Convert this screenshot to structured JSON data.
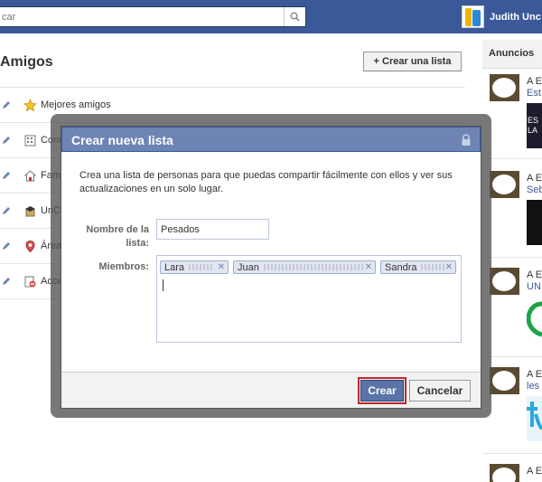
{
  "header": {
    "search_placeholder": "car",
    "user_name": "Judith Unc"
  },
  "page": {
    "title": "Amigos",
    "create_list_label": "+ Crear una lista"
  },
  "lists": [
    {
      "label": "Mejores amigos",
      "icon": "star-icon"
    },
    {
      "label": "Cono",
      "icon": "building-icon"
    },
    {
      "label": "Fam",
      "icon": "house-icon"
    },
    {
      "label": "UnC",
      "icon": "graduation-cap-icon"
    },
    {
      "label": "Área",
      "icon": "location-pin-icon"
    },
    {
      "label": "Acce",
      "icon": "restricted-icon"
    }
  ],
  "ads": {
    "header": "Anuncios",
    "items": [
      {
        "title": "A E",
        "subtitle": "Est",
        "image_text": "ES LA"
      },
      {
        "title": "A E",
        "subtitle": "Seb"
      },
      {
        "title": "A E",
        "subtitle": "UN"
      },
      {
        "title": "A E",
        "subtitle": "les"
      },
      {
        "title": "A E",
        "subtitle": ""
      }
    ]
  },
  "dialog": {
    "title": "Crear nueva lista",
    "description": "Crea una lista de personas para que puedas compartir fácilmente con ellos y ver sus actualizaciones en un solo lugar.",
    "name_label": "Nombre de la lista:",
    "name_value": "Pesados",
    "members_label": "Miembros:",
    "members": [
      "Lara",
      "Juan",
      "Sandra"
    ],
    "create_label": "Crear",
    "cancel_label": "Cancelar"
  },
  "colors": {
    "brand_blue": "#3b5998",
    "dialog_header": "#6d84b4",
    "highlight_red": "#c0282d"
  }
}
